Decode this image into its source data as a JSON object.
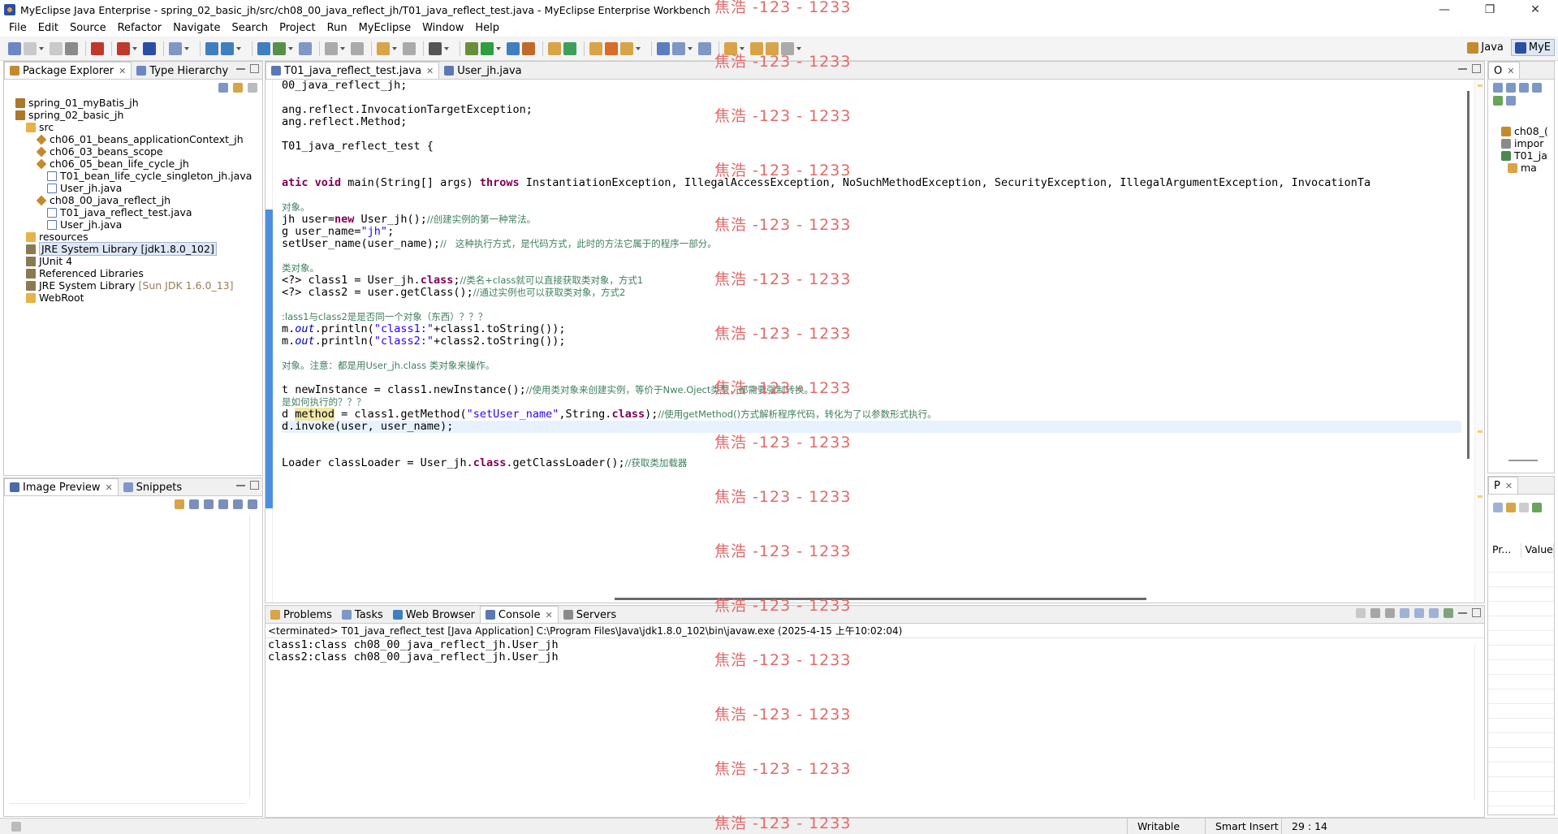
{
  "window": {
    "title": "MyEclipse Java Enterprise - spring_02_basic_jh/src/ch08_00_java_reflect_jh/T01_java_reflect_test.java - MyEclipse Enterprise Workbench",
    "controls": [
      "—",
      "❐",
      "✕"
    ]
  },
  "menu": [
    "File",
    "Edit",
    "Source",
    "Refactor",
    "Navigate",
    "Search",
    "Project",
    "Run",
    "MyEclipse",
    "Window",
    "Help"
  ],
  "perspectives": [
    {
      "label": "Java",
      "active": false
    },
    {
      "label": "MyE",
      "active": true
    }
  ],
  "package_explorer": {
    "tabs": [
      {
        "label": "Package Explorer",
        "active": true
      },
      {
        "label": "Type Hierarchy",
        "active": false
      }
    ],
    "tree": [
      {
        "label": "spring_01_myBatis_jh",
        "suffix": "",
        "icon": "proj",
        "indent": 0,
        "selected": false
      },
      {
        "label": "spring_02_basic_jh",
        "suffix": "",
        "icon": "proj",
        "indent": 0,
        "selected": false
      },
      {
        "label": "src",
        "suffix": "",
        "icon": "folder",
        "indent": 1,
        "selected": false
      },
      {
        "label": "ch06_01_beans_applicationContext_jh",
        "suffix": "",
        "icon": "pkg",
        "indent": 2,
        "selected": false
      },
      {
        "label": "ch06_03_beans_scope",
        "suffix": "",
        "icon": "pkg",
        "indent": 2,
        "selected": false
      },
      {
        "label": "ch06_05_bean_life_cycle_jh",
        "suffix": "",
        "icon": "pkg",
        "indent": 2,
        "selected": false
      },
      {
        "label": "T01_bean_life_cycle_singleton_jh.java",
        "suffix": "",
        "icon": "java",
        "indent": 3,
        "selected": false
      },
      {
        "label": "User_jh.java",
        "suffix": "",
        "icon": "java",
        "indent": 3,
        "selected": false
      },
      {
        "label": "ch08_00_java_reflect_jh",
        "suffix": "",
        "icon": "pkg",
        "indent": 2,
        "selected": false
      },
      {
        "label": "T01_java_reflect_test.java",
        "suffix": "",
        "icon": "java",
        "indent": 3,
        "selected": false
      },
      {
        "label": "User_jh.java",
        "suffix": "",
        "icon": "java",
        "indent": 3,
        "selected": false
      },
      {
        "label": "resources",
        "suffix": "",
        "icon": "folder",
        "indent": 1,
        "selected": false
      },
      {
        "label": "JRE System Library [jdk1.8.0_102]",
        "suffix": "",
        "icon": "lib",
        "indent": 1,
        "selected": true
      },
      {
        "label": "JUnit 4",
        "suffix": "",
        "icon": "lib",
        "indent": 1,
        "selected": false
      },
      {
        "label": "Referenced Libraries",
        "suffix": "",
        "icon": "lib",
        "indent": 1,
        "selected": false
      },
      {
        "label": "JRE System Library ",
        "suffix": "[Sun JDK 1.6.0_13]",
        "icon": "lib",
        "indent": 1,
        "selected": false
      },
      {
        "label": "WebRoot",
        "suffix": "",
        "icon": "folder",
        "indent": 1,
        "selected": false
      }
    ]
  },
  "image_preview": {
    "tabs": [
      {
        "label": "Image Preview",
        "active": true
      },
      {
        "label": "Snippets",
        "active": false
      }
    ]
  },
  "editor": {
    "tabs": [
      {
        "label": "T01_java_reflect_test.java",
        "active": true
      },
      {
        "label": "User_jh.java",
        "active": false
      }
    ],
    "current_line": 28,
    "lines": [
      [
        [
          "00_java_reflect_jh;",
          "p"
        ]
      ],
      [],
      [
        [
          "ang.reflect.InvocationTargetException;",
          "p"
        ]
      ],
      [
        [
          "ang.reflect.Method;",
          "p"
        ]
      ],
      [],
      [
        [
          "T01_java_reflect_test {",
          "p"
        ]
      ],
      [],
      [],
      [
        [
          "atic ",
          "kw"
        ],
        [
          "void",
          "kw"
        ],
        [
          " main(String[] args) ",
          "p"
        ],
        [
          "throws",
          "kw"
        ],
        [
          " InstantiationException, IllegalAccessException, NoSuchMethodException, SecurityException, IllegalArgumentException, InvocationTa",
          "p"
        ]
      ],
      [],
      [
        [
          "对象。",
          "cm"
        ]
      ],
      [
        [
          "jh user=",
          "p"
        ],
        [
          "new",
          "kw"
        ],
        [
          " User_jh();",
          "p"
        ],
        [
          "//创建实例的第一种常法。",
          "cm"
        ]
      ],
      [
        [
          "g user_name=",
          "p"
        ],
        [
          "\"jh\"",
          "str"
        ],
        [
          ";",
          "p"
        ]
      ],
      [
        [
          "setUser_name(user_name);",
          "p"
        ],
        [
          "//   这种执行方式，是代码方式，此时的方法它属于的程序一部分。",
          "cm"
        ]
      ],
      [],
      [
        [
          "类对象。",
          "cm"
        ]
      ],
      [
        [
          "<?> class1 = User_jh.",
          "p"
        ],
        [
          "class",
          "kw"
        ],
        [
          ";",
          "p"
        ],
        [
          "//类名+class就可以直接获取类对象，方式1",
          "cm"
        ]
      ],
      [
        [
          "<?> class2 = user.getClass();",
          "p"
        ],
        [
          "//通过实例也可以获取类对象，方式2",
          "cm"
        ]
      ],
      [],
      [
        [
          ":lass1与class2是是否同一个对象（东西）？？？",
          "cm"
        ]
      ],
      [
        [
          "m.",
          "p"
        ],
        [
          "out",
          "fld"
        ],
        [
          ".println(",
          "p"
        ],
        [
          "\"class1:\"",
          "str"
        ],
        [
          "+class1.toString());",
          "p"
        ]
      ],
      [
        [
          "m.",
          "p"
        ],
        [
          "out",
          "fld"
        ],
        [
          ".println(",
          "p"
        ],
        [
          "\"class2:\"",
          "str"
        ],
        [
          "+class2.toString());",
          "p"
        ]
      ],
      [],
      [
        [
          "对象。注意：都是用User_jh.class 类对象来操作。",
          "cm"
        ]
      ],
      [],
      [
        [
          "t newInstance = class1.newInstance();",
          "p"
        ],
        [
          "//使用类对象来创建实例，等价于Nwe.Oject类型，都需要强制转换。",
          "cm"
        ]
      ],
      [
        [
          "是如何执行的？？？",
          "cm"
        ]
      ],
      [
        [
          "d ",
          "p"
        ],
        [
          "method",
          "hl"
        ],
        [
          " = class1.getMethod(",
          "p"
        ],
        [
          "\"setUser_name\"",
          "str"
        ],
        [
          ",String.",
          "p"
        ],
        [
          "class",
          "kw"
        ],
        [
          ");",
          "p"
        ],
        [
          "//使用getMethod()方式解析程序代码，转化为了以参数形式执行。",
          "cm"
        ]
      ],
      [
        [
          "d.invoke(user, user_name);",
          "p"
        ]
      ],
      [],
      [],
      [
        [
          "Loader classLoader = User_jh.",
          "p"
        ],
        [
          "class",
          "kw"
        ],
        [
          ".getClassLoader();",
          "p"
        ],
        [
          "//获取类加载器",
          "cm"
        ]
      ]
    ]
  },
  "bottom_panel": {
    "tabs": [
      {
        "label": "Problems",
        "active": false
      },
      {
        "label": "Tasks",
        "active": false
      },
      {
        "label": "Web Browser",
        "active": false
      },
      {
        "label": "Console",
        "active": true
      },
      {
        "label": "Servers",
        "active": false
      }
    ],
    "terminated": "<terminated> T01_java_reflect_test [Java Application] C:\\Program Files\\Java\\jdk1.8.0_102\\bin\\javaw.exe (2025-4-15 上午10:02:04)",
    "output": [
      "class1:class ch08_00_java_reflect_jh.User_jh",
      "class2:class ch08_00_java_reflect_jh.User_jh"
    ]
  },
  "outline": {
    "tab": "O",
    "items": [
      {
        "label": "ch08_(",
        "indent": 1
      },
      {
        "label": "impor",
        "indent": 1
      },
      {
        "label": "T01_ja",
        "indent": 1
      },
      {
        "label": "ma",
        "indent": 2
      }
    ]
  },
  "properties": {
    "tab": "P",
    "columns": [
      "Pr...",
      "Value"
    ]
  },
  "status": {
    "writable": "Writable",
    "insert_mode": "Smart Insert",
    "position": "29 : 14"
  },
  "watermark": "焦浩 -123 - 1233",
  "colors": {
    "keyword": "#7f0055",
    "string": "#2a00ff",
    "comment": "#3f7f5f",
    "watermark": "#e06a6a",
    "selection": "#dfe7f5"
  }
}
